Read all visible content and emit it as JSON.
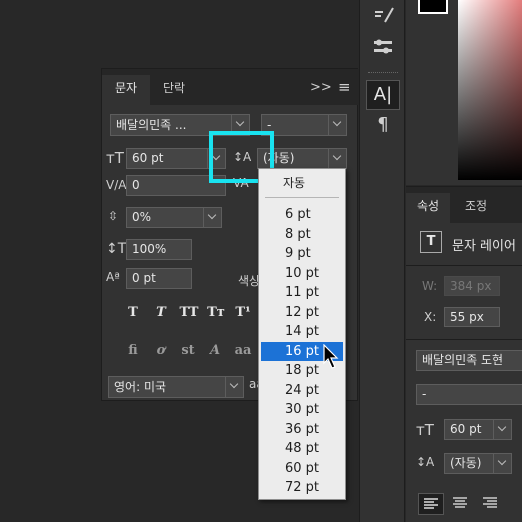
{
  "char_panel": {
    "tabs": [
      "문자",
      "단락"
    ],
    "font_family": "배달의민족 ...",
    "font_style": "-",
    "font_size": "60 pt",
    "leading": "(자동)",
    "kerning": "0",
    "tracking": "0%",
    "vertical_scale": "100%",
    "baseline_shift": "0 pt",
    "color_label": "색상",
    "language": "영어: 미국",
    "style_buttons": [
      "T",
      "T",
      "TT",
      "Tт",
      "T¹"
    ],
    "ot_buttons": [
      "fi",
      "ơ",
      "st",
      "A",
      "aa"
    ],
    "expand_icon": ">>",
    "menu_icon": "≡"
  },
  "leading_menu": {
    "header": "자동",
    "items": [
      "6 pt",
      "8 pt",
      "9 pt",
      "10 pt",
      "11 pt",
      "12 pt",
      "14 pt",
      "16 pt",
      "18 pt",
      "24 pt",
      "30 pt",
      "36 pt",
      "48 pt",
      "60 pt",
      "72 pt"
    ],
    "highlighted": "16 pt"
  },
  "properties_panel": {
    "tabs": [
      "속성",
      "조정"
    ],
    "layer_label": "문자 레이어",
    "w_label": "W:",
    "w_value": "384 px",
    "x_label": "X:",
    "x_value": "55 px",
    "font_family": "배달의민족 도현",
    "font_style": "-",
    "font_size": "60 pt",
    "leading": "(자동)"
  },
  "colors": {
    "highlight_box": "#19e3f0",
    "menu_highlight": "#1c72d6",
    "panel_bg": "#323232",
    "app_bg": "#282828"
  }
}
